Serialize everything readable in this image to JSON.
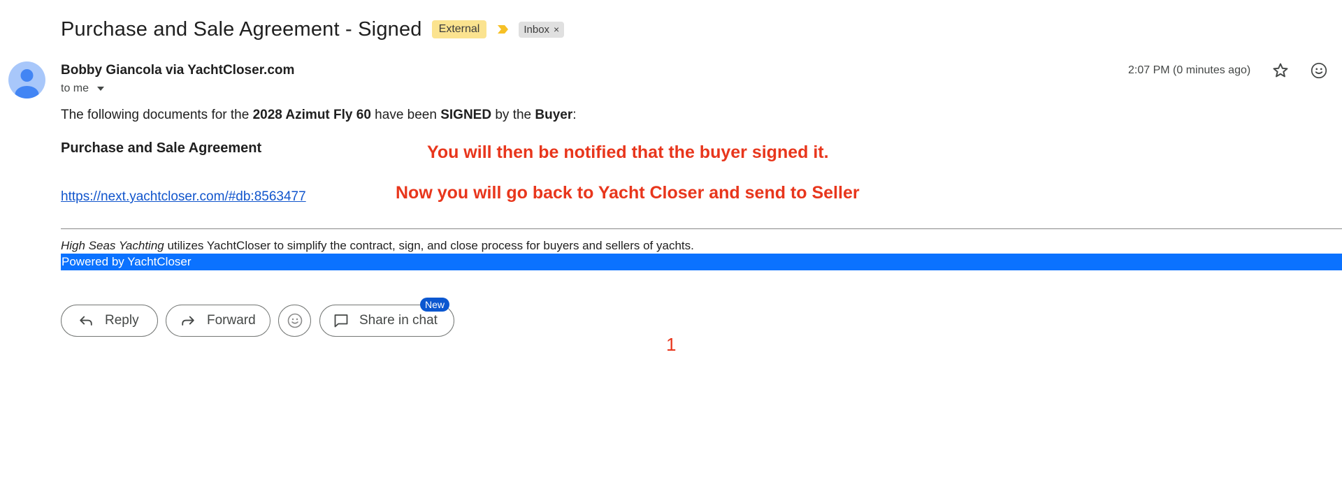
{
  "email": {
    "subject": "Purchase and Sale Agreement - Signed",
    "labels": {
      "external": "External",
      "inbox": "Inbox",
      "inbox_close": "×"
    },
    "sender": "Bobby Giancola via YachtCloser.com",
    "recipient": "to me",
    "timestamp": "2:07 PM (0 minutes ago)",
    "avatar_color": "#a8c7fa"
  },
  "body": {
    "intro_parts": {
      "p1": "The following documents for the ",
      "b1": "2028 Azimut Fly 60",
      "p2": " have been ",
      "b2": "SIGNED",
      "p3": " by the ",
      "b3": "Buyer",
      "p4": ":"
    },
    "document_title": "Purchase and Sale Agreement",
    "document_link": "https://next.yachtcloser.com/#db:8563477",
    "footer": {
      "company": "High Seas Yachting",
      "rest": " utilizes YachtCloser to simplify the contract, sign, and close process for buyers and sellers of yachts."
    },
    "powered_by": "Powered by YachtCloser"
  },
  "annotations": {
    "note1": "You will then be notified that the buyer signed it.",
    "note2": "Now you will go back to Yacht Closer and send to Seller",
    "mark": "1",
    "color": "#e8361c"
  },
  "actions": {
    "reply": "Reply",
    "forward": "Forward",
    "share": "Share in chat",
    "new_badge": "New"
  },
  "icons": {
    "importance": "importance-marker-icon",
    "star": "star-icon",
    "emoji": "emoji-reaction-icon",
    "reply": "reply-arrow-icon",
    "forward": "forward-arrow-icon",
    "chat": "chat-bubble-icon"
  },
  "colors": {
    "external_label": "#fbe38f",
    "powered_bar": "#0b72ff",
    "link": "#1155cc",
    "badge": "#0b57d0"
  }
}
